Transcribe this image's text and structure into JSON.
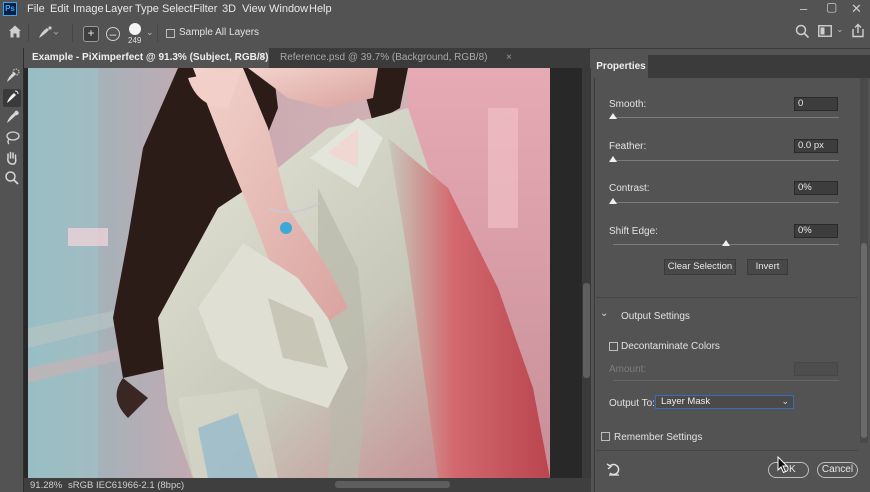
{
  "app": {
    "logo_text": "Ps"
  },
  "menu": [
    "File",
    "Edit",
    "Image",
    "Layer",
    "Type",
    "Select",
    "Filter",
    "3D",
    "View",
    "Window",
    "Help"
  ],
  "options_bar": {
    "brush_size": "249",
    "sample_all_layers_label": "Sample All Layers",
    "sample_all_layers_checked": false
  },
  "tabs": [
    {
      "label": "Example - PiXimperfect @ 91.3% (Subject, RGB/8) *",
      "active": true
    },
    {
      "label": "Reference.psd @ 39.7% (Background, RGB/8)",
      "active": false
    }
  ],
  "status_bar": {
    "zoom": "91.28%",
    "profile": "sRGB IEC61966-2.1 (8bpc)"
  },
  "properties": {
    "title": "Properties",
    "sliders": [
      {
        "label": "Smooth:",
        "value": "0",
        "level": 0
      },
      {
        "label": "Feather:",
        "value": "0.0 px",
        "level": 0
      },
      {
        "label": "Contrast:",
        "value": "0%",
        "level": 0
      },
      {
        "label": "Shift Edge:",
        "value": "0%",
        "level": 0.5
      }
    ],
    "clear_selection_label": "Clear Selection",
    "invert_label": "Invert",
    "output_settings_label": "Output Settings",
    "decontaminate_label": "Decontaminate Colors",
    "amount_label": "Amount:",
    "output_to_label": "Output To:",
    "output_to_value": "Layer Mask",
    "remember_label": "Remember Settings",
    "ok_label": "OK",
    "cancel_label": "Cancel"
  },
  "colors": {
    "accent": "#31a8ff",
    "panel_bg": "#535353",
    "dark_bg": "#282828"
  }
}
